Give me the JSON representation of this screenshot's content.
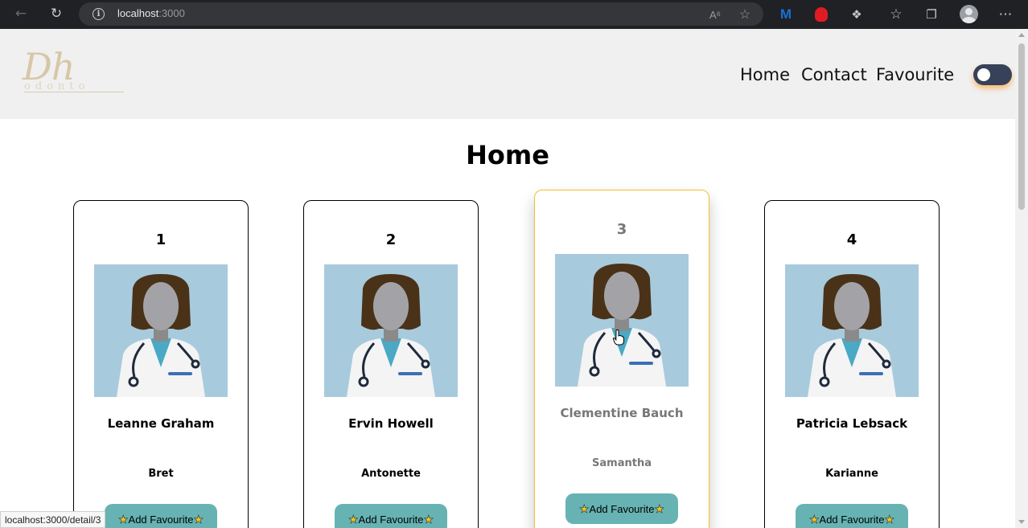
{
  "browser": {
    "url_host": "localhost",
    "url_port": ":3000",
    "status_link": "localhost:3000/detail/3"
  },
  "site": {
    "logo_main": "Dh",
    "logo_sub": "odonto",
    "nav": {
      "home": "Home",
      "contact": "Contact",
      "favourite": "Favourite"
    },
    "theme_toggle": "dark"
  },
  "page": {
    "title": "Home"
  },
  "cards": [
    {
      "id": "1",
      "name": "Leanne Graham",
      "username": "Bret",
      "button": "Add Favourite"
    },
    {
      "id": "2",
      "name": "Ervin Howell",
      "username": "Antonette",
      "button": "Add Favourite"
    },
    {
      "id": "3",
      "name": "Clementine Bauch",
      "username": "Samantha",
      "button": "Add Favourite"
    },
    {
      "id": "4",
      "name": "Patricia Lebsack",
      "username": "Karianne",
      "button": "Add Favourite"
    }
  ],
  "colors": {
    "header_bg": "#f0f0f0",
    "button_bg": "#67b3b3",
    "hover_border": "#f2c12e",
    "avatar_bg": "#a8cadd",
    "toggle_bg": "#37425a"
  }
}
